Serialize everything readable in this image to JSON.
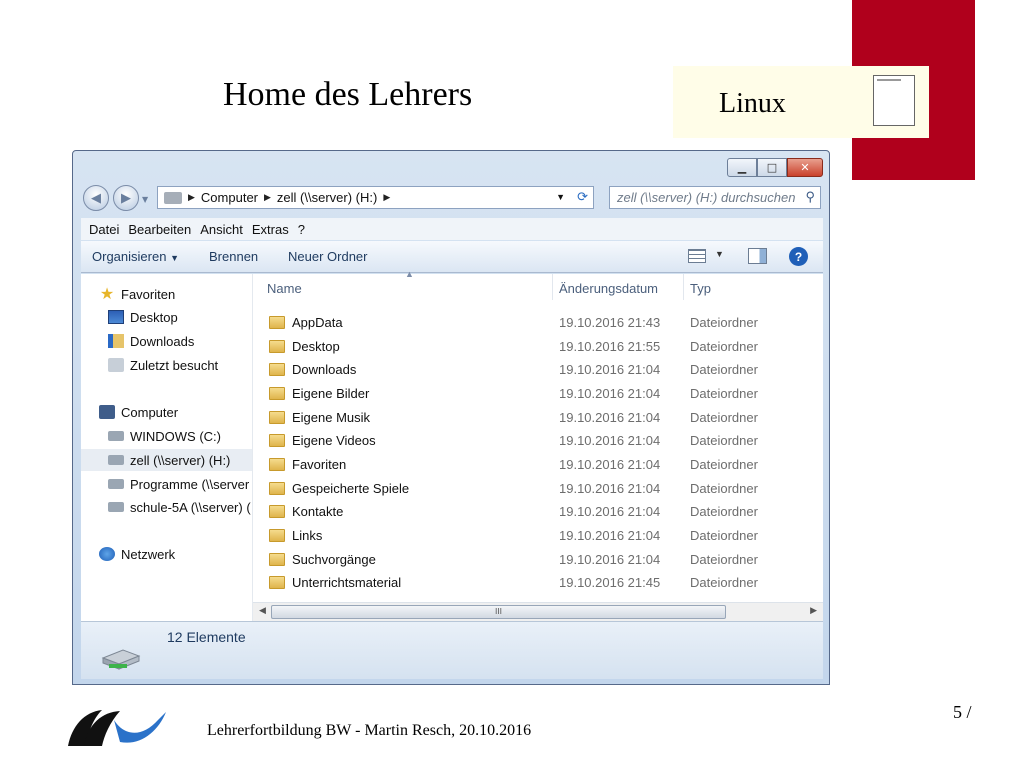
{
  "slide": {
    "title": "Home des Lehrers",
    "badge": "Linux",
    "footer": "Lehrerfortbildung BW - Martin Resch, 20.10.2016",
    "page_number": "5 /"
  },
  "colors": {
    "accent_red": "#b0001c",
    "badge_bg": "#fffde8"
  },
  "window": {
    "controls": [
      "minimize-icon",
      "maximize-icon",
      "close-icon"
    ],
    "breadcrumb": [
      "Computer",
      "zell (\\\\server) (H:)"
    ],
    "search_placeholder": "zell (\\\\server) (H:) durchsuchen",
    "menu": [
      "Datei",
      "Bearbeiten",
      "Ansicht",
      "Extras",
      "?"
    ],
    "commands": {
      "organize": "Organisieren",
      "burn": "Brennen",
      "new_folder": "Neuer Ordner"
    },
    "nav_pane": {
      "favorites": "Favoriten",
      "favorites_items": [
        "Desktop",
        "Downloads",
        "Zuletzt besucht"
      ],
      "computer": "Computer",
      "computer_items": [
        "WINDOWS (C:)",
        "zell (\\\\server) (H:)",
        "Programme (\\\\server",
        "schule-5A (\\\\server) ("
      ],
      "network": "Netzwerk"
    },
    "columns": {
      "name": "Name",
      "date": "Änderungsdatum",
      "type": "Typ"
    },
    "files": [
      {
        "name": "AppData",
        "date": "19.10.2016 21:43",
        "type": "Dateiordner"
      },
      {
        "name": "Desktop",
        "date": "19.10.2016 21:55",
        "type": "Dateiordner"
      },
      {
        "name": "Downloads",
        "date": "19.10.2016 21:04",
        "type": "Dateiordner"
      },
      {
        "name": "Eigene Bilder",
        "date": "19.10.2016 21:04",
        "type": "Dateiordner"
      },
      {
        "name": "Eigene Musik",
        "date": "19.10.2016 21:04",
        "type": "Dateiordner"
      },
      {
        "name": "Eigene Videos",
        "date": "19.10.2016 21:04",
        "type": "Dateiordner"
      },
      {
        "name": "Favoriten",
        "date": "19.10.2016 21:04",
        "type": "Dateiordner"
      },
      {
        "name": "Gespeicherte Spiele",
        "date": "19.10.2016 21:04",
        "type": "Dateiordner"
      },
      {
        "name": "Kontakte",
        "date": "19.10.2016 21:04",
        "type": "Dateiordner"
      },
      {
        "name": "Links",
        "date": "19.10.2016 21:04",
        "type": "Dateiordner"
      },
      {
        "name": "Suchvorgänge",
        "date": "19.10.2016 21:04",
        "type": "Dateiordner"
      },
      {
        "name": "Unterrichtsmaterial",
        "date": "19.10.2016 21:45",
        "type": "Dateiordner"
      }
    ],
    "status": "12 Elemente"
  }
}
